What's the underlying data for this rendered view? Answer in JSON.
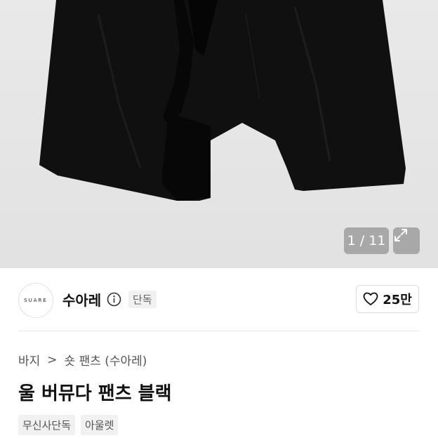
{
  "gallery": {
    "counter": "1 / 11"
  },
  "brand": {
    "logo_text": "SUARE",
    "name": "수아레",
    "badge": "단독"
  },
  "like": {
    "count": "25만"
  },
  "breadcrumb": {
    "level1": "바지",
    "separator": ">",
    "level2": "숏 팬츠 (수아레)"
  },
  "product": {
    "title": "울 버뮤다 팬츠 블랙",
    "tags": [
      "무신사단독",
      "아울렛"
    ]
  },
  "icons": {
    "expand": "expand-icon",
    "info": "info-icon",
    "heart": "heart-icon"
  }
}
